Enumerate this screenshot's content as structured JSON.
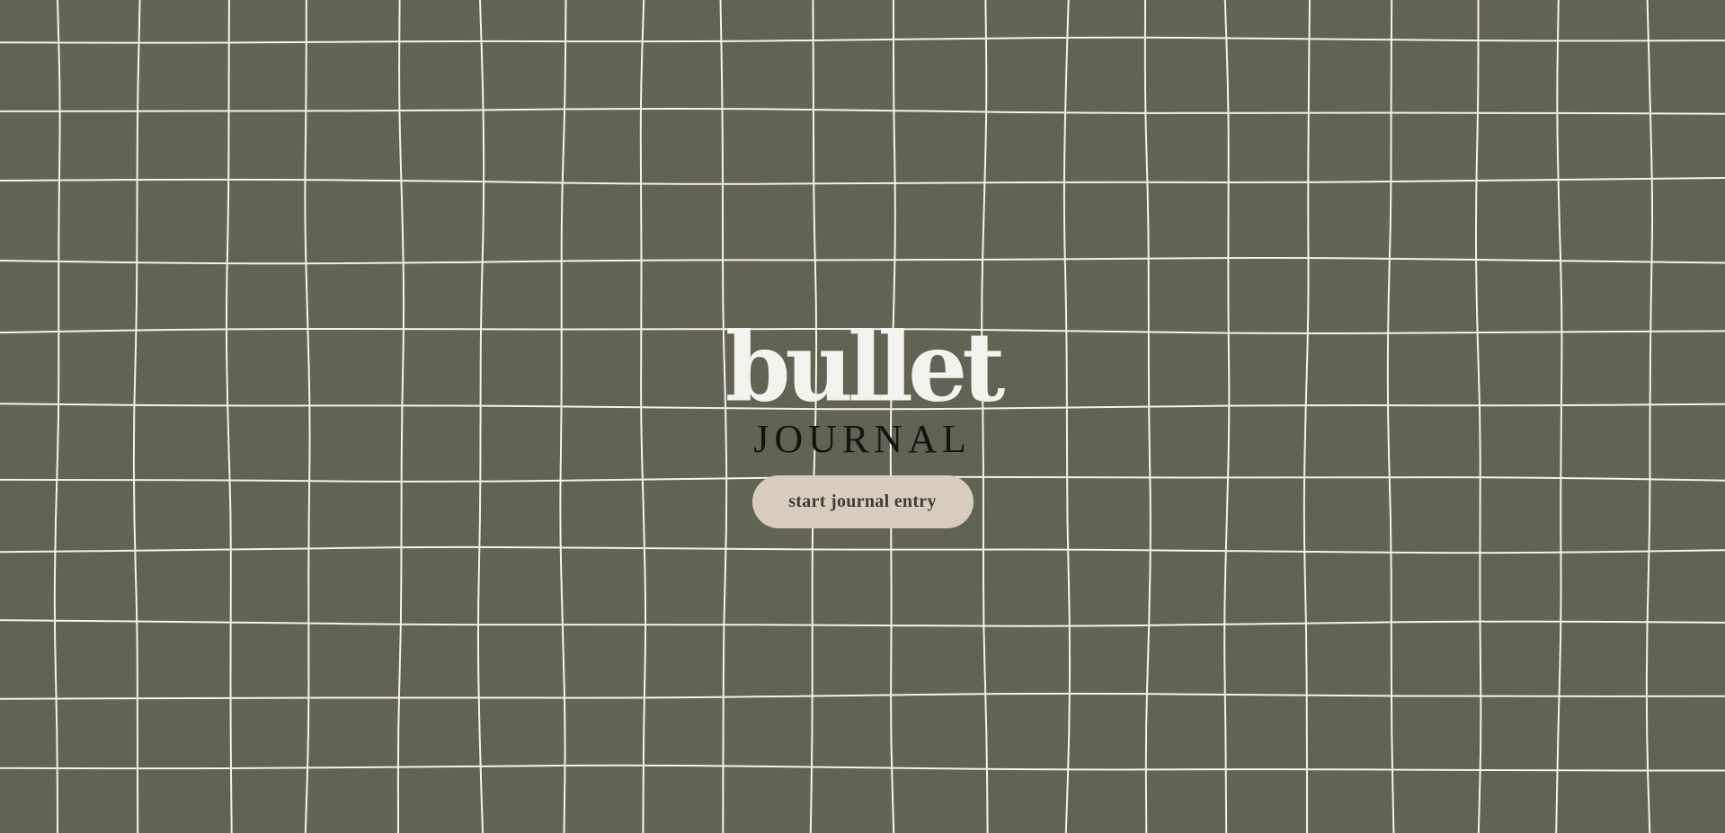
{
  "brand": {
    "title": "bullet",
    "subtitle": "JOURNAL"
  },
  "cta": {
    "label": "start journal entry"
  },
  "colors": {
    "background": "#626355",
    "grid_lines": "#f4f2ec",
    "title": "#f4f2ec",
    "subtitle": "#15140f",
    "button": "#d6cdbf",
    "button_text": "#3d3c36"
  }
}
